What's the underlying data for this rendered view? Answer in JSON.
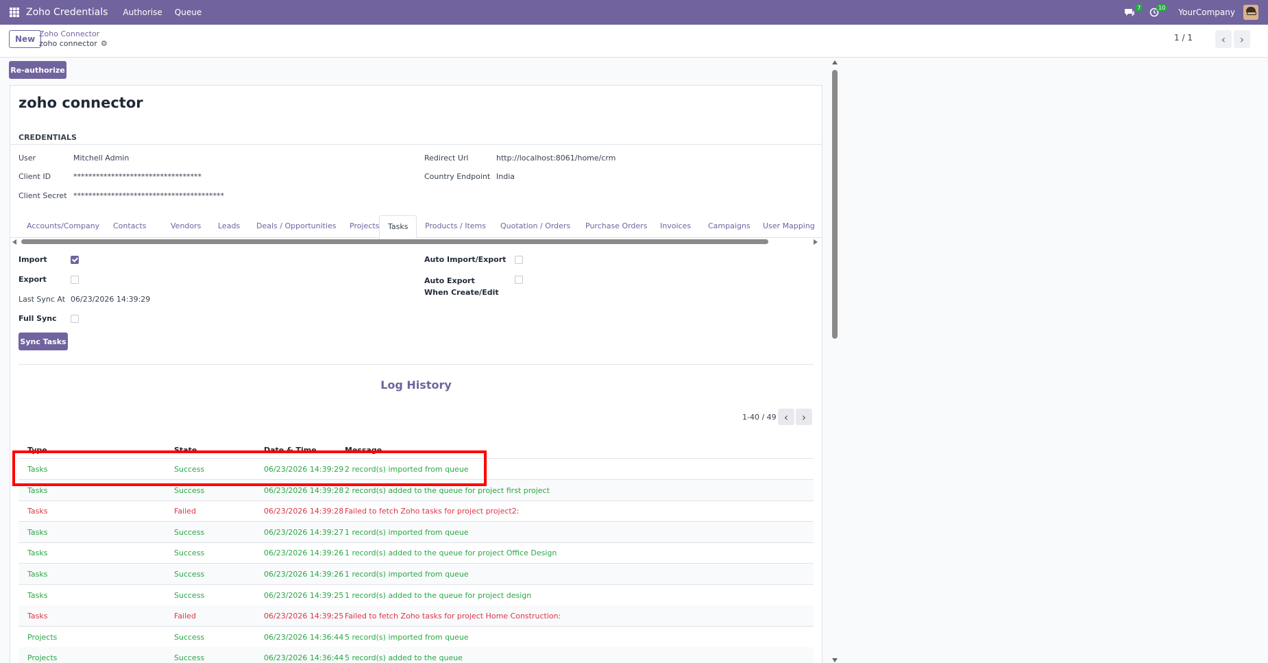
{
  "navbar": {
    "brand": "Zoho Credentials",
    "menus": [
      "Authorise",
      "Queue"
    ],
    "chat_badge": "7",
    "activity_badge": "10",
    "company": "YourCompany"
  },
  "control": {
    "new_label": "New",
    "breadcrumb_parent": "Zoho Connector",
    "breadcrumb_current": "zoho connector",
    "pager": "1 / 1"
  },
  "actions": {
    "reauthorize_label": "Re-authorize"
  },
  "record": {
    "title": "zoho connector",
    "section_title": "CREDENTIALS",
    "user_label": "User",
    "user_value": "Mitchell Admin",
    "client_id_label": "Client ID",
    "client_id_value": "**********************************",
    "client_secret_label": "Client Secret",
    "client_secret_value": "****************************************",
    "redirect_url_label": "Redirect Url",
    "redirect_url_value": "http://localhost:8061/home/crm",
    "country_endpoint_label": "Country Endpoint",
    "country_endpoint_value": "India"
  },
  "tabs": [
    "Accounts/Company",
    "Contacts",
    "Vendors",
    "Leads",
    "Deals / Opportunities",
    "Projects",
    "Tasks",
    "Products / Items",
    "Quotation / Orders",
    "Purchase Orders",
    "Invoices",
    "Campaigns",
    "User Mapping"
  ],
  "active_tab": "Tasks",
  "tasks_tab": {
    "import_label": "Import",
    "import_checked": true,
    "export_label": "Export",
    "export_checked": false,
    "last_sync_label": "Last Sync At",
    "last_sync_value": "06/23/2026 14:39:29",
    "full_sync_label": "Full Sync",
    "full_sync_checked": false,
    "auto_import_export_label": "Auto Import/Export",
    "auto_import_export_checked": false,
    "auto_export_label": "Auto Export When Create/Edit",
    "auto_export_checked": false,
    "sync_button_label": "Sync Tasks"
  },
  "log_history": {
    "title": "Log History",
    "pager": "1-40 / 49",
    "columns": [
      "Type",
      "State",
      "Date & Time",
      "Message"
    ],
    "rows": [
      {
        "type": "Tasks",
        "state": "Success",
        "datetime": "06/23/2026 14:39:29",
        "message": "2 record(s) imported from queue",
        "status": "ok"
      },
      {
        "type": "Tasks",
        "state": "Success",
        "datetime": "06/23/2026 14:39:28",
        "message": "2 record(s) added to the queue for project first project",
        "status": "ok"
      },
      {
        "type": "Tasks",
        "state": "Failed",
        "datetime": "06/23/2026 14:39:28",
        "message": "Failed to fetch Zoho tasks for project project2:",
        "status": "fail"
      },
      {
        "type": "Tasks",
        "state": "Success",
        "datetime": "06/23/2026 14:39:27",
        "message": "1 record(s) imported from queue",
        "status": "ok"
      },
      {
        "type": "Tasks",
        "state": "Success",
        "datetime": "06/23/2026 14:39:26",
        "message": "1 record(s) added to the queue for project Office Design",
        "status": "ok"
      },
      {
        "type": "Tasks",
        "state": "Success",
        "datetime": "06/23/2026 14:39:26",
        "message": "1 record(s) imported from queue",
        "status": "ok"
      },
      {
        "type": "Tasks",
        "state": "Success",
        "datetime": "06/23/2026 14:39:25",
        "message": "1 record(s) added to the queue for project design",
        "status": "ok"
      },
      {
        "type": "Tasks",
        "state": "Failed",
        "datetime": "06/23/2026 14:39:25",
        "message": "Failed to fetch Zoho tasks for project Home Construction:",
        "status": "fail"
      },
      {
        "type": "Projects",
        "state": "Success",
        "datetime": "06/23/2026 14:36:44",
        "message": "5 record(s) imported from queue",
        "status": "ok"
      },
      {
        "type": "Projects",
        "state": "Success",
        "datetime": "06/23/2026 14:36:44",
        "message": "5 record(s) added to the queue",
        "status": "ok"
      }
    ]
  },
  "colors": {
    "brand": "#71639e",
    "success": "#28a745",
    "failed": "#dc3545",
    "highlight": "#ff0000"
  }
}
